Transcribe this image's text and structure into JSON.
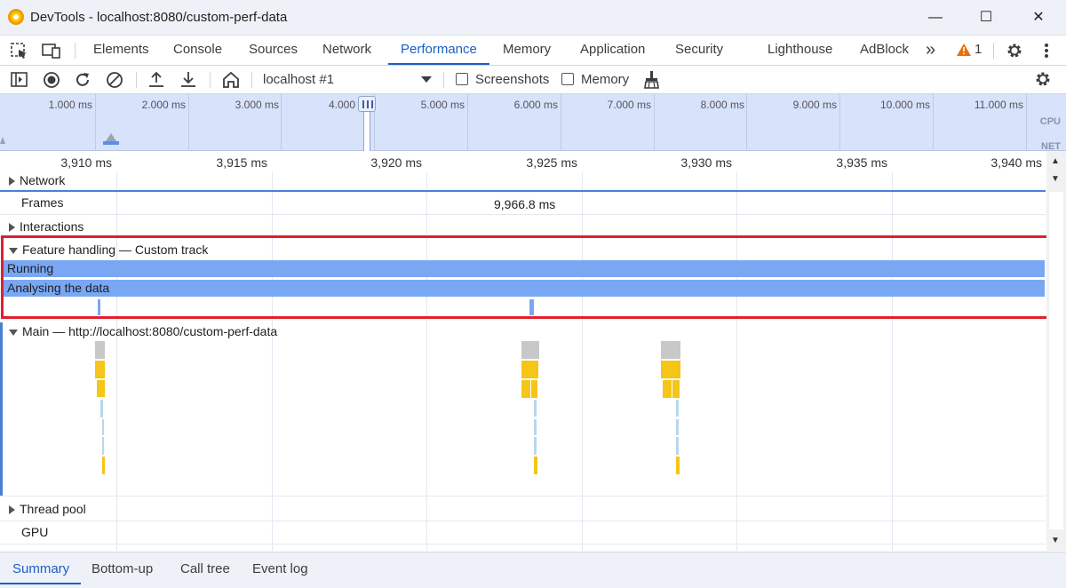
{
  "window": {
    "title": "DevTools - localhost:8080/custom-perf-data",
    "minimize": "—",
    "maximize": "☐",
    "close": "✕"
  },
  "tabs": {
    "items": [
      "Elements",
      "Console",
      "Sources",
      "Network",
      "Performance",
      "Memory",
      "Application",
      "Security",
      "Lighthouse",
      "AdBlock"
    ],
    "active": "Performance",
    "more": "»",
    "warning_count": "1"
  },
  "toolbar": {
    "target": "localhost #1",
    "screenshots_label": "Screenshots",
    "memory_label": "Memory"
  },
  "overview": {
    "ticks": [
      "1.000 ms",
      "2.000 ms",
      "3.000 ms",
      "4.000",
      "5.000 ms",
      "6.000 ms",
      "7.000 ms",
      "8.000 ms",
      "9.000 ms",
      "10.000 ms",
      "11.000 ms"
    ],
    "cpu_label": "CPU",
    "net_label": "NET"
  },
  "ruler": {
    "ticks": [
      "3,910 ms",
      "3,915 ms",
      "3,920 ms",
      "3,925 ms",
      "3,930 ms",
      "3,935 ms",
      "3,940 ms"
    ]
  },
  "tracks": {
    "network": "Network",
    "frames": "Frames",
    "frames_value": "9,966.8 ms",
    "interactions": "Interactions",
    "custom": "Feature handling — Custom track",
    "custom_running": "Running",
    "custom_analysing": "Analysing the data",
    "main": "Main — http://localhost:8080/custom-perf-data",
    "thread_pool": "Thread pool",
    "gpu": "GPU"
  },
  "bottom_tabs": {
    "items": [
      "Summary",
      "Bottom-up",
      "Call tree",
      "Event log"
    ],
    "active": "Summary"
  },
  "colors": {
    "accent": "#1b5fc7",
    "custom_track": "#7aa7f4",
    "highlight": "#e0202e",
    "scripting": "#f5c518",
    "task": "#c8c8c8",
    "warning": "#e8710a"
  }
}
